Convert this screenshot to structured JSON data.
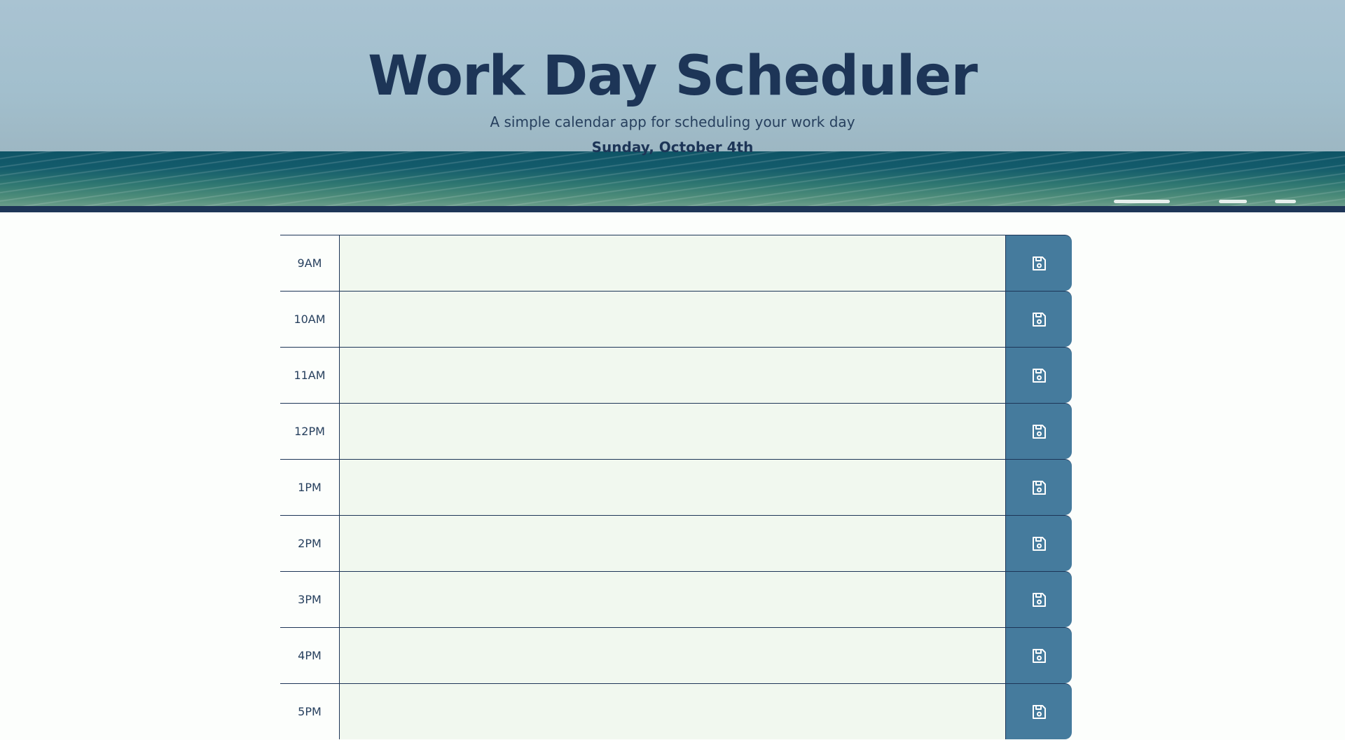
{
  "header": {
    "title": "Work Day Scheduler",
    "subtitle": "A simple calendar app for scheduling your work day",
    "current_date": "Sunday, October 4th"
  },
  "timeblocks": [
    {
      "hour": "9AM",
      "text": ""
    },
    {
      "hour": "10AM",
      "text": ""
    },
    {
      "hour": "11AM",
      "text": ""
    },
    {
      "hour": "12PM",
      "text": ""
    },
    {
      "hour": "1PM",
      "text": ""
    },
    {
      "hour": "2PM",
      "text": ""
    },
    {
      "hour": "3PM",
      "text": ""
    },
    {
      "hour": "4PM",
      "text": ""
    },
    {
      "hour": "5PM",
      "text": ""
    }
  ],
  "save_icon": "save-floppy-icon",
  "colors": {
    "navy": "#1d3557",
    "save_button": "#457b9d",
    "textarea_bg": "#f1f8ef",
    "page_bg": "#fcfefc"
  }
}
